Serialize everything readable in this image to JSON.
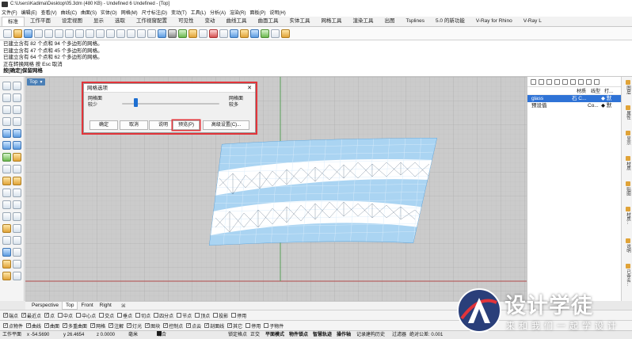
{
  "window": {
    "title": "C:\\Users\\Kadima\\Desktop\\05.3dm (480 KB) - Undefined 6 Undefined - [Top]"
  },
  "menu": [
    "文件(F)",
    "编辑(E)",
    "查看(V)",
    "曲线(C)",
    "曲面(S)",
    "实体(O)",
    "网格(M)",
    "尺寸标注(D)",
    "变动(T)",
    "工具(L)",
    "分析(A)",
    "渲染(R)",
    "面板(P)",
    "说明(H)"
  ],
  "tabs": [
    "标准",
    "工作平面",
    "设定视图",
    "显示",
    "选取",
    "工作视窗配置",
    "可见性",
    "变动",
    "曲线工具",
    "曲面工具",
    "实体工具",
    "网格工具",
    "渲染工具",
    "出图",
    "Tsplines",
    "5.0 的新功能",
    "V-Ray for Rhino",
    "V-Ray L"
  ],
  "active_tab": "标准",
  "command_history": [
    "已建立含有 82 个点和 94 个多边形的网格。",
    "已建立含有 47 个点和 45 个多边形的网格。",
    "已建立含有 64 个点和 62 个多边形的网格。",
    "正在转换网格    按 Esc 取消",
    "按[确定]保留网格"
  ],
  "viewport": {
    "label": "Top",
    "dropdown_caret": "▼"
  },
  "mesh_dialog": {
    "title": "网格选项",
    "close": "✕",
    "left_label_1": "网格面",
    "left_label_2": "较少",
    "right_label_1": "网格面",
    "right_label_2": "较多",
    "density_fraction": 0.12,
    "buttons": {
      "ok": "确定",
      "cancel": "取消",
      "help": "说明",
      "preview": "预览(P)",
      "advanced": "高级设置(C)..."
    }
  },
  "layers_panel": {
    "columns": {
      "material": "材质",
      "linetype": "线型",
      "print": "打..."
    },
    "rows": [
      {
        "name": "glass",
        "material": "石 C...",
        "print": "◆ 默",
        "selected": true
      },
      {
        "name": "预设值",
        "material": "Co...",
        "print": "◆ 默",
        "selected": false
      }
    ],
    "side_tabs": [
      "图层",
      "属性",
      "显示",
      "材质",
      "贴图",
      "材质...",
      "说明",
      "已命名..."
    ]
  },
  "view_tabs": {
    "items": [
      "Perspective",
      "Top",
      "Front",
      "Right"
    ],
    "active": "Top",
    "add": "⌘"
  },
  "osnaps": [
    {
      "label": "端点",
      "checked": true
    },
    {
      "label": "最近点",
      "checked": true
    },
    {
      "label": "点",
      "checked": true
    },
    {
      "label": "中点",
      "checked": false
    },
    {
      "label": "中心点",
      "checked": false
    },
    {
      "label": "交点",
      "checked": false
    },
    {
      "label": "垂点",
      "checked": false
    },
    {
      "label": "切点",
      "checked": false
    },
    {
      "label": "四分点",
      "checked": false
    },
    {
      "label": "节点",
      "checked": false
    },
    {
      "label": "顶点",
      "checked": false
    },
    {
      "label": "投影",
      "checked": false
    },
    {
      "label": "停用",
      "checked": false
    }
  ],
  "filters": [
    {
      "label": "点物件",
      "checked": true
    },
    {
      "label": "曲线",
      "checked": true
    },
    {
      "label": "曲面",
      "checked": true
    },
    {
      "label": "多重曲面",
      "checked": true
    },
    {
      "label": "网格",
      "checked": true
    },
    {
      "label": "注解",
      "checked": true
    },
    {
      "label": "灯光",
      "checked": true
    },
    {
      "label": "图块",
      "checked": true
    },
    {
      "label": "控制点",
      "checked": true
    },
    {
      "label": "点云",
      "checked": true
    },
    {
      "label": "剖面线",
      "checked": true
    },
    {
      "label": "其它",
      "checked": true
    },
    {
      "label": "停用",
      "checked": false
    },
    {
      "label": "子物件",
      "checked": false
    }
  ],
  "status": {
    "cplane": "工作平面",
    "x": "x -54.5690",
    "y": "y 26.4654",
    "z": "z 0.0000",
    "unit": "毫米",
    "layer": "混合",
    "modes": [
      "锁定格点",
      "正交",
      "平面模式",
      "物件锁点",
      "智慧轨迹",
      "操作轴",
      "记录建构历史",
      "过滤器"
    ],
    "tolerance": "绝对公差: 0.001"
  },
  "watermark": {
    "brand": "设计学徒",
    "slogan": "来和我们一起学设计"
  },
  "colors": {
    "accent": "#2f73d6",
    "highlight": "#e2343a",
    "viewport_bg": "#cbcbcb",
    "mesh_fill": "#aad4f2"
  }
}
